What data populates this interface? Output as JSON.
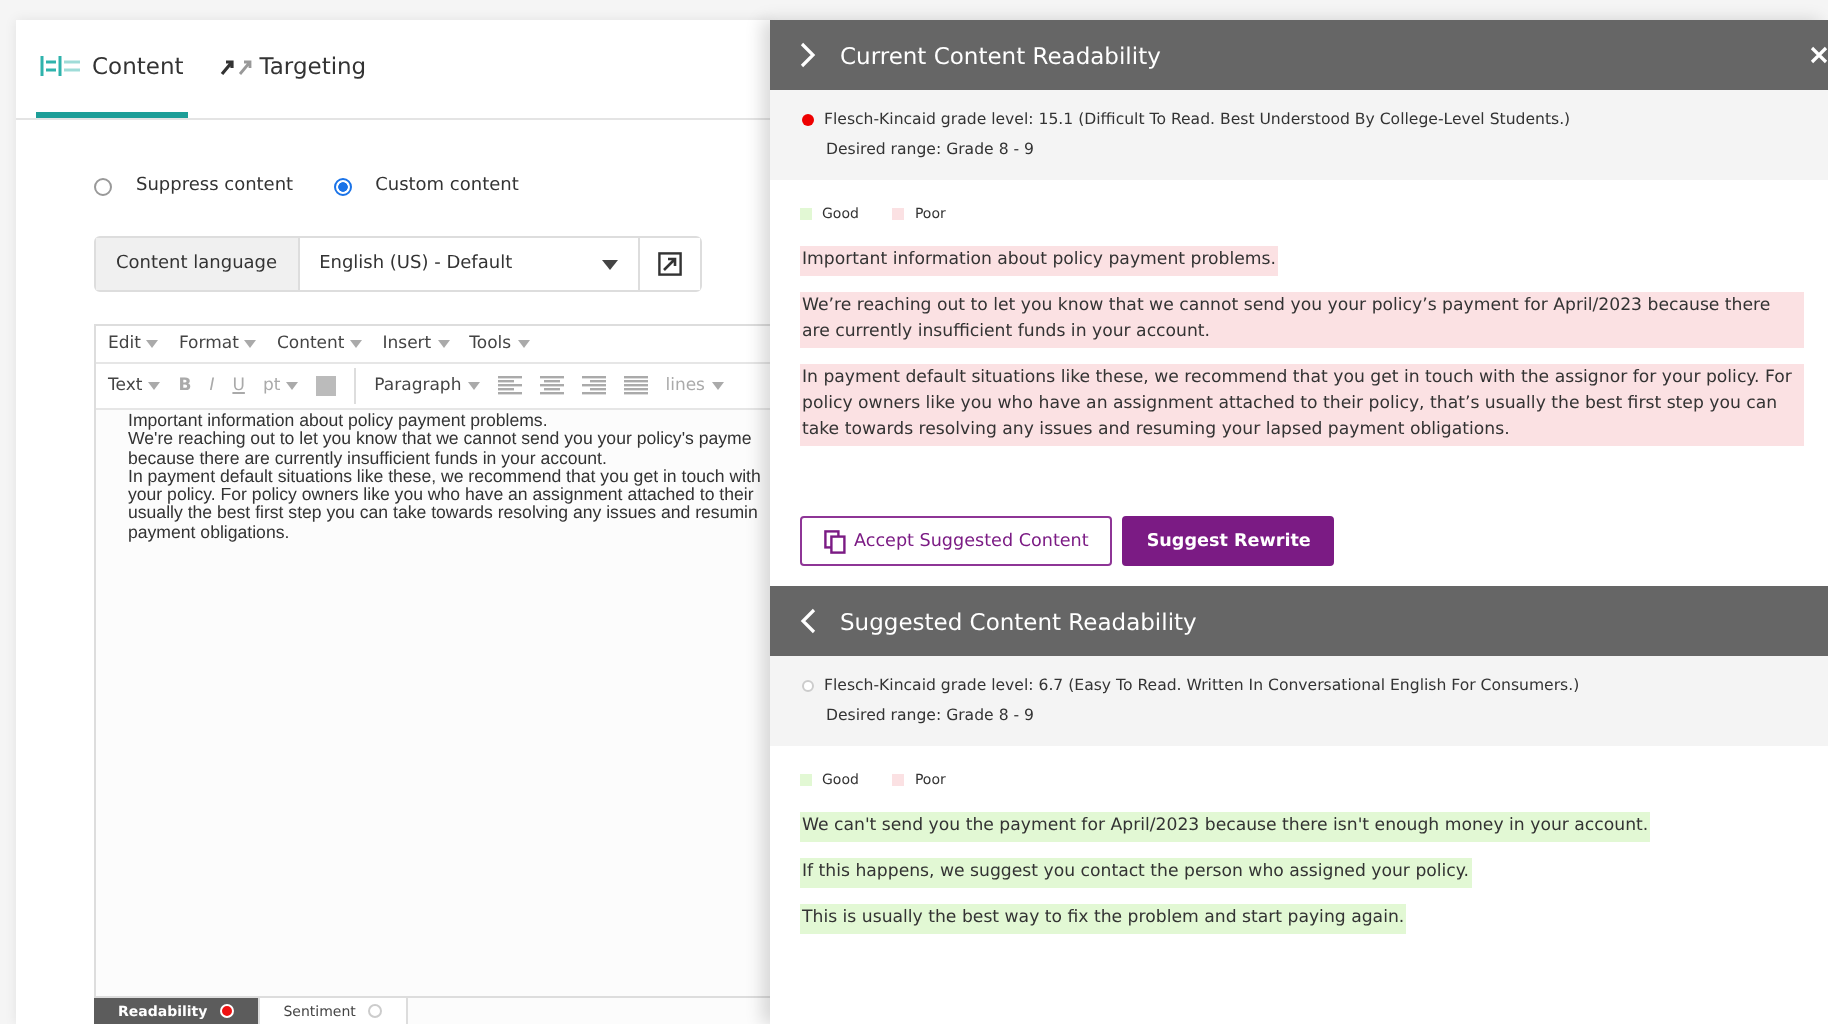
{
  "tabs": [
    {
      "label": "Content",
      "selected": true
    },
    {
      "label": "Targeting",
      "selected": false
    }
  ],
  "content_mode": [
    {
      "label": "Suppress content",
      "selected": false
    },
    {
      "label": "Custom content",
      "selected": true
    }
  ],
  "content_language": {
    "label": "Content language",
    "value": "English (US) - Default"
  },
  "editor": {
    "menu": [
      "Edit",
      "Format",
      "Content",
      "Insert",
      "Tools"
    ],
    "toolbar": [
      {
        "kind": "dropdown",
        "label": "Text",
        "disabled": false
      },
      {
        "kind": "bold",
        "label": "B",
        "disabled": true
      },
      {
        "kind": "italic",
        "label": "I",
        "disabled": true
      },
      {
        "kind": "underline",
        "label": "U",
        "disabled": true
      },
      {
        "kind": "dropdown",
        "label": "pt",
        "disabled": true
      },
      {
        "kind": "swatch",
        "disabled": true
      },
      {
        "kind": "separator"
      },
      {
        "kind": "dropdown",
        "label": "Paragraph",
        "disabled": false
      },
      {
        "kind": "alignleft",
        "disabled": true
      },
      {
        "kind": "aligncenter",
        "disabled": true
      },
      {
        "kind": "alignright",
        "disabled": true
      },
      {
        "kind": "alignjustify",
        "disabled": true
      },
      {
        "kind": "dropdown",
        "label": "lines",
        "disabled": true
      }
    ],
    "lines": [
      "Important information about policy payment problems.",
      "We're reaching out to let you know that we cannot send you your policy's payme",
      "because there are currently insufficient funds in your account.",
      "In payment default situations like these, we recommend that you get in touch with",
      "your policy. For policy owners like you who have an assignment attached to their",
      "usually the best first step you can take towards resolving any issues and resumin",
      "payment obligations."
    ]
  },
  "analysis_tabs": [
    {
      "label": "Readability",
      "selected": true,
      "alert": true
    },
    {
      "label": "Sentiment",
      "selected": false,
      "alert": false
    }
  ],
  "sections": [
    {
      "title": "Current Content Readability",
      "expanded": false,
      "alert": true,
      "grade": "Flesch-Kincaid grade level: 15.1 (Difficult To Read. Best Understood By College-Level Students.)",
      "range": "Desired range: Grade 8 - 9",
      "legend": [
        {
          "label": "Good",
          "color": "#e2f8d4"
        },
        {
          "label": "Poor",
          "color": "#fbe1e3"
        }
      ],
      "paragraphs": [
        {
          "text": "Important information about policy payment problems.",
          "color": "#fbe1e3"
        },
        {
          "text": "We’re reaching out to let you know that we cannot send you your policy’s payment for April/2023 because there are currently insufficient funds in your account.",
          "color": "#fbe1e3"
        },
        {
          "text": "In payment default situations like these, we recommend that you get in touch with the assignor for your policy. For policy owners like you who have an assignment attached to their policy, that’s usually the best first step you can take towards resolving any issues and resuming your lapsed payment obligations.",
          "color": "#fbe1e3"
        }
      ],
      "buttons": [
        {
          "label": "Accept Suggested Content",
          "kind": "outline"
        },
        {
          "label": "Suggest Rewrite",
          "kind": "primary"
        }
      ]
    },
    {
      "title": "Suggested Content Readability",
      "expanded": true,
      "alert": false,
      "grade": "Flesch-Kincaid grade level: 6.7 (Easy To Read. Written In Conversational English For Consumers.)",
      "range": "Desired range: Grade 8 - 9",
      "legend": [
        {
          "label": "Good",
          "color": "#e2f8d4"
        },
        {
          "label": "Poor",
          "color": "#fbe1e3"
        }
      ],
      "paragraphs": [
        {
          "text": "We can't send you the payment for April/2023 because there isn't enough money in your account.",
          "color": "#e2f8d4"
        },
        {
          "text": "If this happens, we suggest you contact the person who assigned your policy.",
          "color": "#e2f8d4"
        },
        {
          "text": "This is usually the best way to fix the problem and start paying again.",
          "color": "#e2f8d4"
        }
      ]
    }
  ]
}
